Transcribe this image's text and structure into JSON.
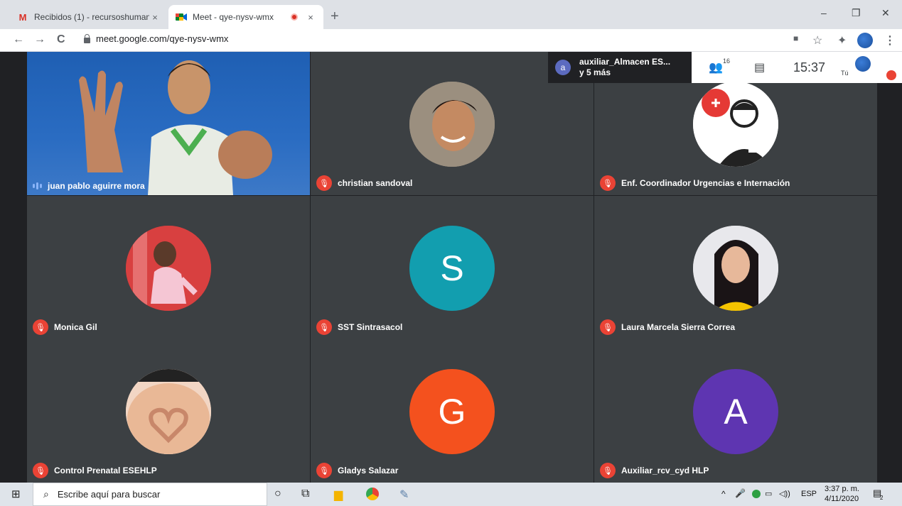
{
  "browser": {
    "tabs": [
      {
        "title": "Recibidos (1) - recursoshumanos",
        "icon": "gmail-icon",
        "close": "×"
      },
      {
        "title": "Meet - qye-nysv-wmx",
        "icon": "meet-icon",
        "close": "×"
      }
    ],
    "new_tab": "+",
    "window_controls": {
      "minimize": "–",
      "restore": "❐",
      "close": "✕"
    },
    "url": "meet.google.com/qye-nysv-wmx",
    "nav": {
      "back": "←",
      "forward": "→",
      "reload": "C"
    }
  },
  "meet": {
    "presenter_badge": {
      "initial": "a",
      "line1": "auxiliar_Almacen ES...",
      "line2": "y 5 más"
    },
    "participants_count": "16",
    "clock": "15:37",
    "self_label": "Tú"
  },
  "participants": [
    {
      "name": "juan pablo aguirre mora",
      "type": "video"
    },
    {
      "name": "christian sandoval",
      "type": "photo",
      "muted": true
    },
    {
      "name": "Enf. Coordinador Urgencias e Internación",
      "type": "photo",
      "muted": true
    },
    {
      "name": "Monica Gil",
      "type": "photo",
      "muted": true
    },
    {
      "name": "SST Sintrasacol",
      "type": "letter",
      "letter": "S",
      "color": "#129eaf",
      "muted": true
    },
    {
      "name": "Laura Marcela Sierra Correa",
      "type": "photo",
      "muted": true
    },
    {
      "name": "Control Prenatal ESEHLP",
      "type": "photo",
      "muted": true
    },
    {
      "name": "Gladys Salazar",
      "type": "letter",
      "letter": "G",
      "color": "#f4511e",
      "muted": true
    },
    {
      "name": "Auxiliar_rcv_cyd HLP",
      "type": "letter",
      "letter": "A",
      "color": "#5e35b1",
      "muted": true
    }
  ],
  "taskbar": {
    "search_placeholder": "Escribe aquí para buscar",
    "language": "ESP",
    "time": "3:37 p. m.",
    "date": "4/11/2020",
    "notifications": "2"
  }
}
